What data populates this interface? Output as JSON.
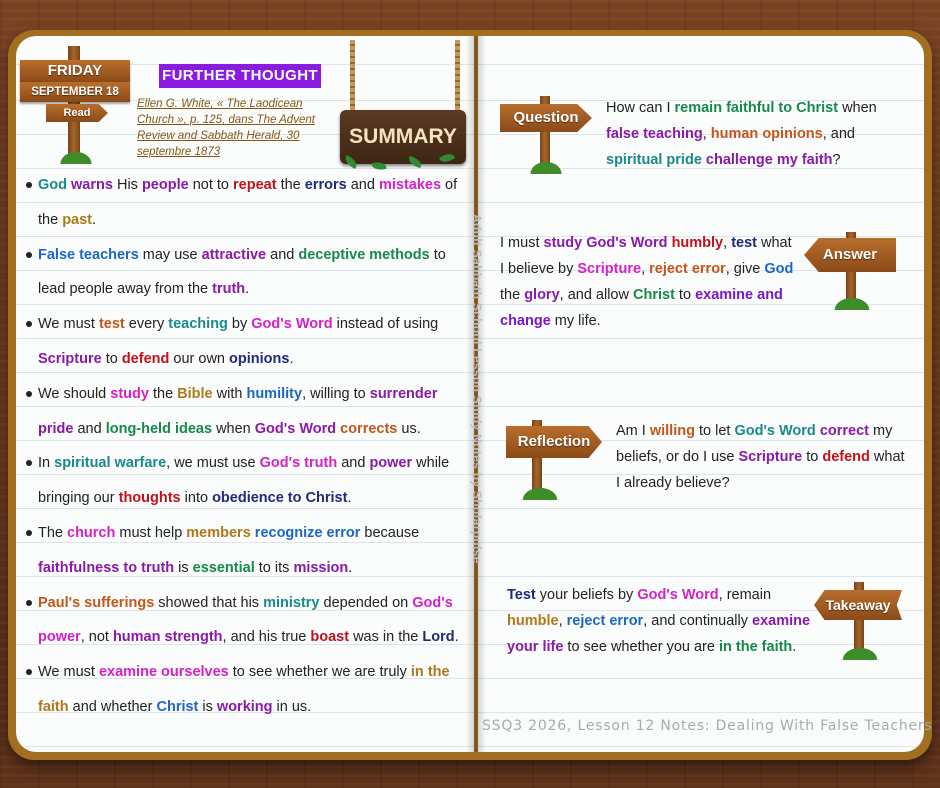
{
  "header": {
    "day": "FRIDAY",
    "date": "SEPTEMBER 18",
    "read_label": "Read",
    "further_thought": "FURTHER THOUGHT",
    "citation": "Ellen G. White, « The Laodicean Church », p. 125, dans The Advent Review and Sabbath Herald, 30 septembre 1873",
    "summary_label": "SUMMARY"
  },
  "vertical_caption": "Adult Sabbath School Lesson Study Notes by Shofarpulse",
  "bullets": [
    [
      [
        "God",
        "teal"
      ],
      [
        " ",
        ""
      ],
      [
        "warns",
        "purple"
      ],
      [
        " His ",
        ""
      ],
      [
        "people",
        "purple"
      ],
      [
        " not to ",
        ""
      ],
      [
        "repeat",
        "red"
      ],
      [
        " the ",
        ""
      ],
      [
        "errors",
        "navy"
      ],
      [
        " and ",
        ""
      ],
      [
        "mistakes",
        "magenta"
      ],
      [
        " of the ",
        ""
      ],
      [
        "past",
        "gold"
      ],
      [
        ".",
        ""
      ]
    ],
    [
      [
        "False teachers",
        "blue"
      ],
      [
        " may use ",
        ""
      ],
      [
        "attractive",
        "purple"
      ],
      [
        " and ",
        ""
      ],
      [
        "deceptive methods",
        "green"
      ],
      [
        " to lead people away from the ",
        ""
      ],
      [
        "truth",
        "purple"
      ],
      [
        ".",
        ""
      ]
    ],
    [
      [
        "We must ",
        ""
      ],
      [
        "test",
        "orange"
      ],
      [
        " every ",
        ""
      ],
      [
        "teaching",
        "teal"
      ],
      [
        " by ",
        ""
      ],
      [
        "God's Word",
        "magenta"
      ],
      [
        " instead of using ",
        ""
      ],
      [
        "Scripture",
        "purple"
      ],
      [
        " to ",
        ""
      ],
      [
        "defend",
        "red"
      ],
      [
        " our own ",
        ""
      ],
      [
        "opinions",
        "navy"
      ],
      [
        ".",
        ""
      ]
    ],
    [
      [
        "We should ",
        ""
      ],
      [
        "study",
        "magenta"
      ],
      [
        " the ",
        ""
      ],
      [
        "Bible",
        "gold"
      ],
      [
        " with ",
        ""
      ],
      [
        "humility",
        "blue"
      ],
      [
        ", willing to ",
        ""
      ],
      [
        "surrender",
        "purple"
      ],
      [
        " ",
        ""
      ],
      [
        "pride",
        "purple"
      ],
      [
        " and ",
        ""
      ],
      [
        "long-held ideas",
        "green"
      ],
      [
        " when ",
        ""
      ],
      [
        "God's Word",
        "purple"
      ],
      [
        " ",
        ""
      ],
      [
        "corrects",
        "orange"
      ],
      [
        " us.",
        ""
      ]
    ],
    [
      [
        "In ",
        ""
      ],
      [
        "spiritual warfare",
        "teal"
      ],
      [
        ", we must use ",
        ""
      ],
      [
        "God's truth",
        "magenta"
      ],
      [
        " and ",
        ""
      ],
      [
        "power",
        "purple"
      ],
      [
        " while bringing our ",
        ""
      ],
      [
        "thoughts",
        "red"
      ],
      [
        " into ",
        ""
      ],
      [
        "obedience to Christ",
        "navy"
      ],
      [
        ".",
        ""
      ]
    ],
    [
      [
        "The ",
        ""
      ],
      [
        "church",
        "magenta"
      ],
      [
        " must help ",
        ""
      ],
      [
        "members",
        "gold"
      ],
      [
        " ",
        ""
      ],
      [
        "recognize error",
        "blue"
      ],
      [
        " because ",
        ""
      ],
      [
        "faithfulness to truth",
        "purple"
      ],
      [
        " is ",
        ""
      ],
      [
        "essential",
        "green"
      ],
      [
        " to its ",
        ""
      ],
      [
        "mission",
        "purple"
      ],
      [
        ".",
        ""
      ]
    ],
    [
      [
        "Paul's sufferings",
        "orange"
      ],
      [
        " showed that his ",
        ""
      ],
      [
        "ministry",
        "teal"
      ],
      [
        " depended on ",
        ""
      ],
      [
        "God's power",
        "magenta"
      ],
      [
        ", not ",
        ""
      ],
      [
        "human strength",
        "purple"
      ],
      [
        ", and his true ",
        ""
      ],
      [
        "boast",
        "red"
      ],
      [
        " was in the ",
        ""
      ],
      [
        "Lord",
        "navy"
      ],
      [
        ".",
        ""
      ]
    ],
    [
      [
        "We must ",
        ""
      ],
      [
        "examine ourselves",
        "magenta"
      ],
      [
        " to see whether we are truly ",
        ""
      ],
      [
        "in the faith",
        "gold"
      ],
      [
        " and whether ",
        ""
      ],
      [
        "Christ",
        "blue"
      ],
      [
        " is ",
        ""
      ],
      [
        "working",
        "purple"
      ],
      [
        " in us.",
        ""
      ]
    ]
  ],
  "sections": {
    "question": {
      "sign": "Question",
      "text": [
        [
          "How can I ",
          ""
        ],
        [
          "remain faithful to Christ",
          "green"
        ],
        [
          " when ",
          ""
        ],
        [
          "false teaching",
          "purple"
        ],
        [
          ", ",
          ""
        ],
        [
          "human opinions",
          "orange"
        ],
        [
          ", and ",
          ""
        ],
        [
          "spiritual pride",
          "teal"
        ],
        [
          " ",
          ""
        ],
        [
          "challenge my faith",
          "purple"
        ],
        [
          "?",
          ""
        ]
      ]
    },
    "answer": {
      "sign": "Answer",
      "text": [
        [
          "I must ",
          ""
        ],
        [
          "study God's Word",
          "purple"
        ],
        [
          " ",
          ""
        ],
        [
          "humbly",
          "red"
        ],
        [
          ", ",
          ""
        ],
        [
          "test",
          "navy"
        ],
        [
          " what I believe by ",
          ""
        ],
        [
          "Scripture",
          "magenta"
        ],
        [
          ", ",
          ""
        ],
        [
          "reject error",
          "orange"
        ],
        [
          ", give ",
          ""
        ],
        [
          "God",
          "blue"
        ],
        [
          " the ",
          ""
        ],
        [
          "glory",
          "purple"
        ],
        [
          ", and allow ",
          ""
        ],
        [
          "Christ",
          "green"
        ],
        [
          " to ",
          ""
        ],
        [
          "examine and change",
          "violet"
        ],
        [
          " my life.",
          ""
        ]
      ]
    },
    "reflection": {
      "sign": "Reflection",
      "text": [
        [
          "Am I ",
          ""
        ],
        [
          "willing",
          "orange"
        ],
        [
          " to let ",
          ""
        ],
        [
          "God's Word",
          "teal"
        ],
        [
          " ",
          ""
        ],
        [
          "correct",
          "purple"
        ],
        [
          " my beliefs, or do I use ",
          ""
        ],
        [
          "Scripture",
          "purple"
        ],
        [
          " to ",
          ""
        ],
        [
          "defend",
          "red"
        ],
        [
          " what I already believe?",
          ""
        ]
      ]
    },
    "takeaway": {
      "sign": "Takeaway",
      "text": [
        [
          "Test",
          "navy"
        ],
        [
          " your beliefs by ",
          ""
        ],
        [
          "God's Word",
          "magenta"
        ],
        [
          ", remain ",
          ""
        ],
        [
          "humble",
          "gold"
        ],
        [
          ", ",
          ""
        ],
        [
          "reject error",
          "blue"
        ],
        [
          ", and continually ",
          ""
        ],
        [
          "examine your life",
          "purple"
        ],
        [
          " to see whether you are ",
          ""
        ],
        [
          "in the faith",
          "green"
        ],
        [
          ".",
          ""
        ]
      ]
    }
  },
  "footer": "SSQ3 2026, Lesson 12 Notes: Dealing With False Teachers",
  "colors": {
    "further_thought_bg": "#8a1ce0",
    "cover": "#a26f21",
    "wood_sign": "#a05a22"
  }
}
